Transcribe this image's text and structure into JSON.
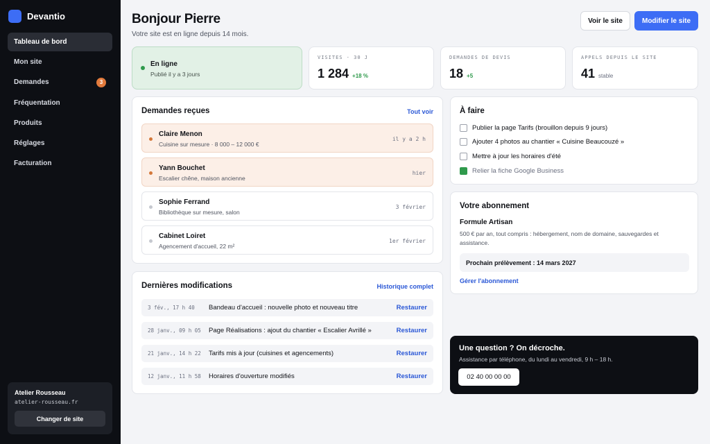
{
  "brand": {
    "name": "Devantio",
    "logo_color": "#3d6df5"
  },
  "sidebar": {
    "items": [
      {
        "label": "Tableau de bord",
        "active": true
      },
      {
        "label": "Mon site"
      },
      {
        "label": "Demandes",
        "badge": "3"
      },
      {
        "label": "Fréquentation"
      },
      {
        "label": "Produits"
      },
      {
        "label": "Réglages"
      },
      {
        "label": "Facturation"
      }
    ],
    "site": {
      "name": "Atelier Rousseau",
      "domain": "atelier-rousseau.fr",
      "switch_label": "Changer de site"
    }
  },
  "header": {
    "title": "Bonjour Pierre",
    "subtitle": "Votre site est en ligne depuis 14 mois.",
    "view_label": "Voir le site",
    "edit_label": "Modifier le site"
  },
  "status": {
    "title": "En ligne",
    "subtitle": "Publié il y a 3 jours"
  },
  "stats": [
    {
      "label": "VISITES · 30 J",
      "value": "1 284",
      "extra": "+18 %"
    },
    {
      "label": "DEMANDES DE DEVIS",
      "value": "18",
      "extra": "+5"
    },
    {
      "label": "APPELS DEPUIS LE SITE",
      "value": "41",
      "extra": "stable"
    }
  ],
  "requests": {
    "title": "Demandes reçues",
    "link": "Tout voir",
    "items": [
      {
        "name": "Claire Menon",
        "desc": "Cuisine sur mesure · 8 000 – 12 000 €",
        "time": "il y a 2 h",
        "new": true
      },
      {
        "name": "Yann Bouchet",
        "desc": "Escalier chêne, maison ancienne",
        "time": "hier",
        "new": true
      },
      {
        "name": "Sophie Ferrand",
        "desc": "Bibliothèque sur mesure, salon",
        "time": "3 février",
        "new": false
      },
      {
        "name": "Cabinet Loiret",
        "desc": "Agencement d'accueil, 22 m²",
        "time": "1er février",
        "new": false
      }
    ]
  },
  "modifications": {
    "title": "Dernières modifications",
    "link": "Historique complet",
    "restore_label": "Restaurer",
    "items": [
      {
        "date": "3 fév., 17 h 40",
        "text": "Bandeau d'accueil : nouvelle photo et nouveau titre"
      },
      {
        "date": "28 janv., 09 h 05",
        "text": "Page Réalisations : ajout du chantier « Escalier Avrillé »"
      },
      {
        "date": "21 janv., 14 h 22",
        "text": "Tarifs mis à jour (cuisines et agencements)"
      },
      {
        "date": "12 janv., 11 h 58",
        "text": "Horaires d'ouverture modifiés"
      }
    ]
  },
  "todo": {
    "title": "À faire",
    "items": [
      {
        "label": "Publier la page Tarifs (brouillon depuis 9 jours)",
        "done": false
      },
      {
        "label": "Ajouter 4 photos au chantier « Cuisine Beaucouzé »",
        "done": false
      },
      {
        "label": "Mettre à jour les horaires d'été",
        "done": false
      },
      {
        "label": "Relier la fiche Google Business",
        "done": true
      }
    ]
  },
  "subscription": {
    "title": "Votre abonnement",
    "plan": "Formule Artisan",
    "desc": "500 € par an, tout compris : hébergement, nom de domaine, sauvegardes et assistance.",
    "next": "Prochain prélèvement : 14 mars 2027",
    "manage": "Gérer l'abonnement"
  },
  "help": {
    "title": "Une question ? On décroche.",
    "subtitle": "Assistance par téléphone, du lundi au vendredi, 9 h – 18 h.",
    "phone": "02 40 00 00 00"
  }
}
